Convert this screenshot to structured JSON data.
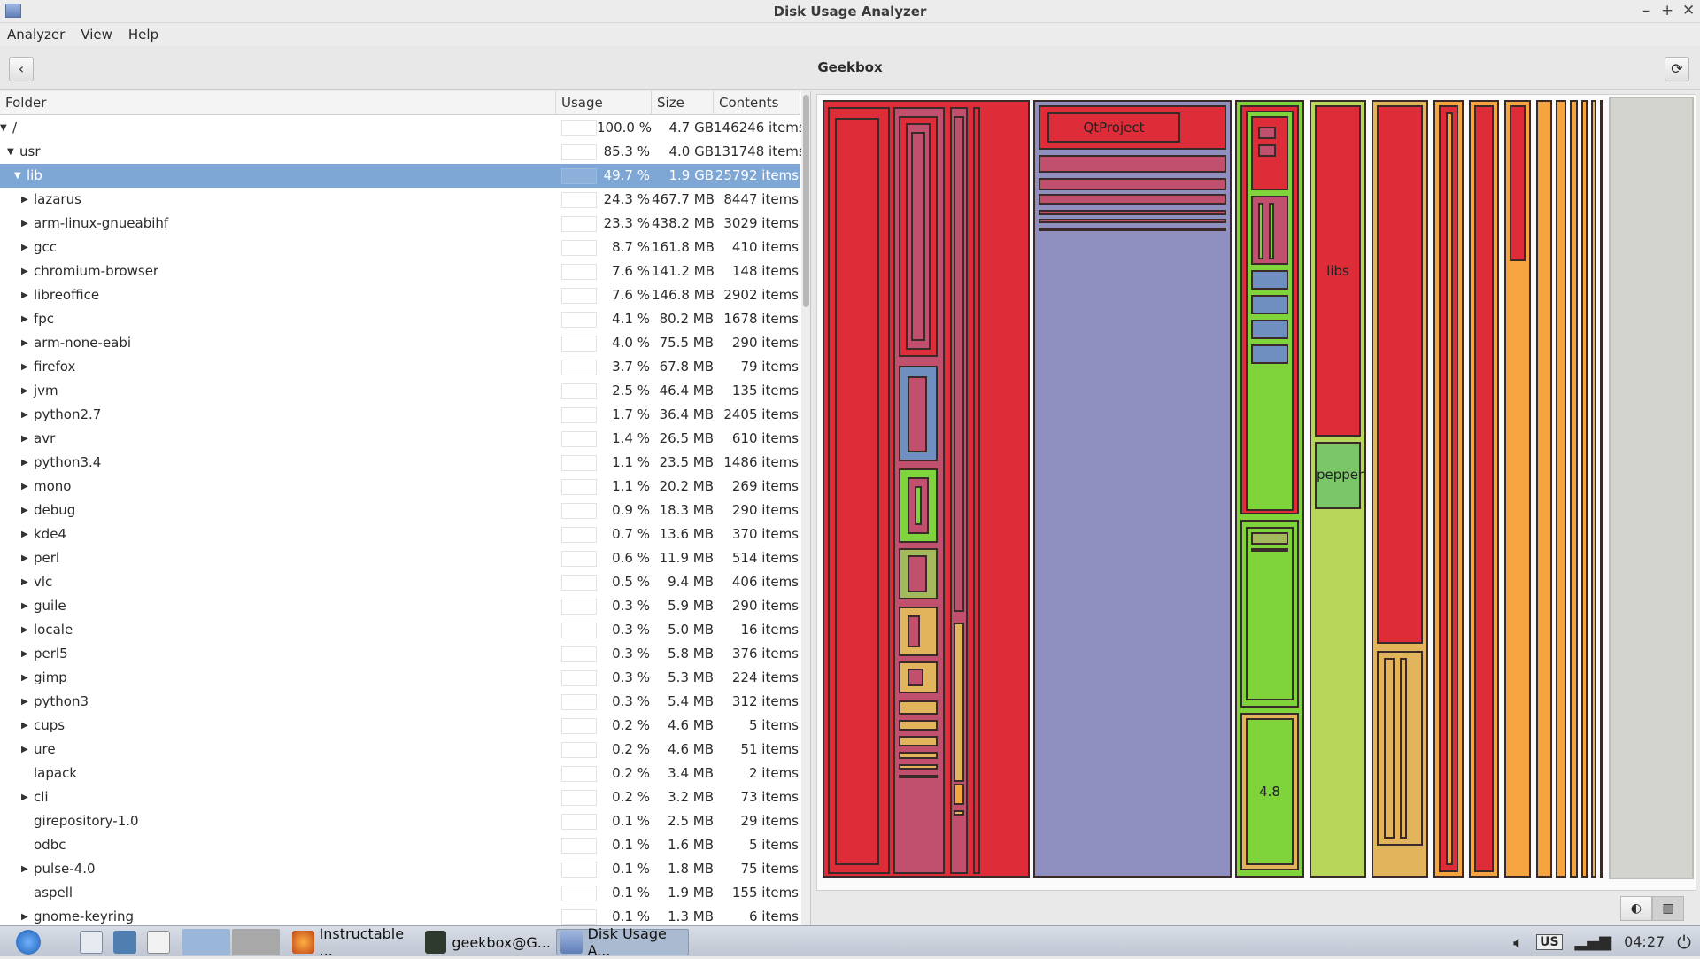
{
  "window": {
    "title": "Disk Usage Analyzer",
    "controls": [
      "–",
      "+",
      "✕"
    ]
  },
  "menu": [
    "Analyzer",
    "View",
    "Help"
  ],
  "toolbar": {
    "back_icon": "back-arrow-icon",
    "location": "Geekbox",
    "refresh_icon": "refresh-icon"
  },
  "tree": {
    "columns": [
      "Folder",
      "Usage",
      "Size",
      "Contents"
    ],
    "rows": [
      {
        "name": "/",
        "indent": 0,
        "expander": "▼",
        "pct": "100.0 %",
        "size": "4.7 GB",
        "contents": "146246 items"
      },
      {
        "name": "usr",
        "indent": 1,
        "expander": "▼",
        "pct": "85.3 %",
        "size": "4.0 GB",
        "contents": "131748 items"
      },
      {
        "name": "lib",
        "indent": 2,
        "expander": "▼",
        "pct": "49.7 %",
        "size": "1.9 GB",
        "contents": "25792 items",
        "selected": true
      },
      {
        "name": "lazarus",
        "indent": 3,
        "expander": "▶",
        "pct": "24.3 %",
        "size": "467.7 MB",
        "contents": "8447 items"
      },
      {
        "name": "arm-linux-gnueabihf",
        "indent": 3,
        "expander": "▶",
        "pct": "23.3 %",
        "size": "438.2 MB",
        "contents": "3029 items"
      },
      {
        "name": "gcc",
        "indent": 3,
        "expander": "▶",
        "pct": "8.7 %",
        "size": "161.8 MB",
        "contents": "410 items"
      },
      {
        "name": "chromium-browser",
        "indent": 3,
        "expander": "▶",
        "pct": "7.6 %",
        "size": "141.2 MB",
        "contents": "148 items"
      },
      {
        "name": "libreoffice",
        "indent": 3,
        "expander": "▶",
        "pct": "7.6 %",
        "size": "146.8 MB",
        "contents": "2902 items"
      },
      {
        "name": "fpc",
        "indent": 3,
        "expander": "▶",
        "pct": "4.1 %",
        "size": "80.2 MB",
        "contents": "1678 items"
      },
      {
        "name": "arm-none-eabi",
        "indent": 3,
        "expander": "▶",
        "pct": "4.0 %",
        "size": "75.5 MB",
        "contents": "290 items"
      },
      {
        "name": "firefox",
        "indent": 3,
        "expander": "▶",
        "pct": "3.7 %",
        "size": "67.8 MB",
        "contents": "79 items"
      },
      {
        "name": "jvm",
        "indent": 3,
        "expander": "▶",
        "pct": "2.5 %",
        "size": "46.4 MB",
        "contents": "135 items"
      },
      {
        "name": "python2.7",
        "indent": 3,
        "expander": "▶",
        "pct": "1.7 %",
        "size": "36.4 MB",
        "contents": "2405 items"
      },
      {
        "name": "avr",
        "indent": 3,
        "expander": "▶",
        "pct": "1.4 %",
        "size": "26.5 MB",
        "contents": "610 items"
      },
      {
        "name": "python3.4",
        "indent": 3,
        "expander": "▶",
        "pct": "1.1 %",
        "size": "23.5 MB",
        "contents": "1486 items"
      },
      {
        "name": "mono",
        "indent": 3,
        "expander": "▶",
        "pct": "1.1 %",
        "size": "20.2 MB",
        "contents": "269 items"
      },
      {
        "name": "debug",
        "indent": 3,
        "expander": "▶",
        "pct": "0.9 %",
        "size": "18.3 MB",
        "contents": "290 items"
      },
      {
        "name": "kde4",
        "indent": 3,
        "expander": "▶",
        "pct": "0.7 %",
        "size": "13.6 MB",
        "contents": "370 items"
      },
      {
        "name": "perl",
        "indent": 3,
        "expander": "▶",
        "pct": "0.6 %",
        "size": "11.9 MB",
        "contents": "514 items"
      },
      {
        "name": "vlc",
        "indent": 3,
        "expander": "▶",
        "pct": "0.5 %",
        "size": "9.4 MB",
        "contents": "406 items"
      },
      {
        "name": "guile",
        "indent": 3,
        "expander": "▶",
        "pct": "0.3 %",
        "size": "5.9 MB",
        "contents": "290 items"
      },
      {
        "name": "locale",
        "indent": 3,
        "expander": "▶",
        "pct": "0.3 %",
        "size": "5.0 MB",
        "contents": "16 items"
      },
      {
        "name": "perl5",
        "indent": 3,
        "expander": "▶",
        "pct": "0.3 %",
        "size": "5.8 MB",
        "contents": "376 items"
      },
      {
        "name": "gimp",
        "indent": 3,
        "expander": "▶",
        "pct": "0.3 %",
        "size": "5.3 MB",
        "contents": "224 items"
      },
      {
        "name": "python3",
        "indent": 3,
        "expander": "▶",
        "pct": "0.3 %",
        "size": "5.4 MB",
        "contents": "312 items"
      },
      {
        "name": "cups",
        "indent": 3,
        "expander": "▶",
        "pct": "0.2 %",
        "size": "4.6 MB",
        "contents": "5 items"
      },
      {
        "name": "ure",
        "indent": 3,
        "expander": "▶",
        "pct": "0.2 %",
        "size": "4.6 MB",
        "contents": "51 items"
      },
      {
        "name": "lapack",
        "indent": 3,
        "expander": "",
        "pct": "0.2 %",
        "size": "3.4 MB",
        "contents": "2 items"
      },
      {
        "name": "cli",
        "indent": 3,
        "expander": "▶",
        "pct": "0.2 %",
        "size": "3.2 MB",
        "contents": "73 items"
      },
      {
        "name": "girepository-1.0",
        "indent": 3,
        "expander": "",
        "pct": "0.1 %",
        "size": "2.5 MB",
        "contents": "29 items"
      },
      {
        "name": "odbc",
        "indent": 3,
        "expander": "",
        "pct": "0.1 %",
        "size": "1.6 MB",
        "contents": "5 items"
      },
      {
        "name": "pulse-4.0",
        "indent": 3,
        "expander": "▶",
        "pct": "0.1 %",
        "size": "1.8 MB",
        "contents": "75 items"
      },
      {
        "name": "aspell",
        "indent": 3,
        "expander": "",
        "pct": "0.1 %",
        "size": "1.9 MB",
        "contents": "155 items"
      },
      {
        "name": "gnome-keyring",
        "indent": 3,
        "expander": "▶",
        "pct": "0.1 %",
        "size": "1.3 MB",
        "contents": "6 items"
      }
    ]
  },
  "treemap": {
    "labels": {
      "qtproject": "QtProject",
      "libs": "libs",
      "pepper": "pepper",
      "gcc48": "4.8"
    },
    "colors": {
      "red": "#de2d38",
      "mauve": "#c0506e",
      "lavender": "#9090c0",
      "green": "#7ed43a",
      "light_green": "#b7d65a",
      "orange": "#f6a440",
      "tan": "#e2b45c",
      "gray": "#d4d4cf"
    }
  },
  "view_toggle": [
    "rings-chart-icon",
    "treemap-chart-icon"
  ],
  "taskbar": {
    "launchers": [
      "start-menu-icon",
      "file-manager-icon",
      "network-icon",
      "window-icon"
    ],
    "tasks": [
      {
        "label": "Instructable ...",
        "icon": "firefox-icon"
      },
      {
        "label": "geekbox@G...",
        "icon": "terminal-icon"
      },
      {
        "label": "Disk Usage A...",
        "icon": "disk-usage-icon",
        "active": true
      }
    ],
    "tray": {
      "volume_icon": "volume-icon",
      "keyboard": "US",
      "network_icon": "signal-icon",
      "clock": "04:27",
      "power_icon": "power-icon"
    }
  }
}
